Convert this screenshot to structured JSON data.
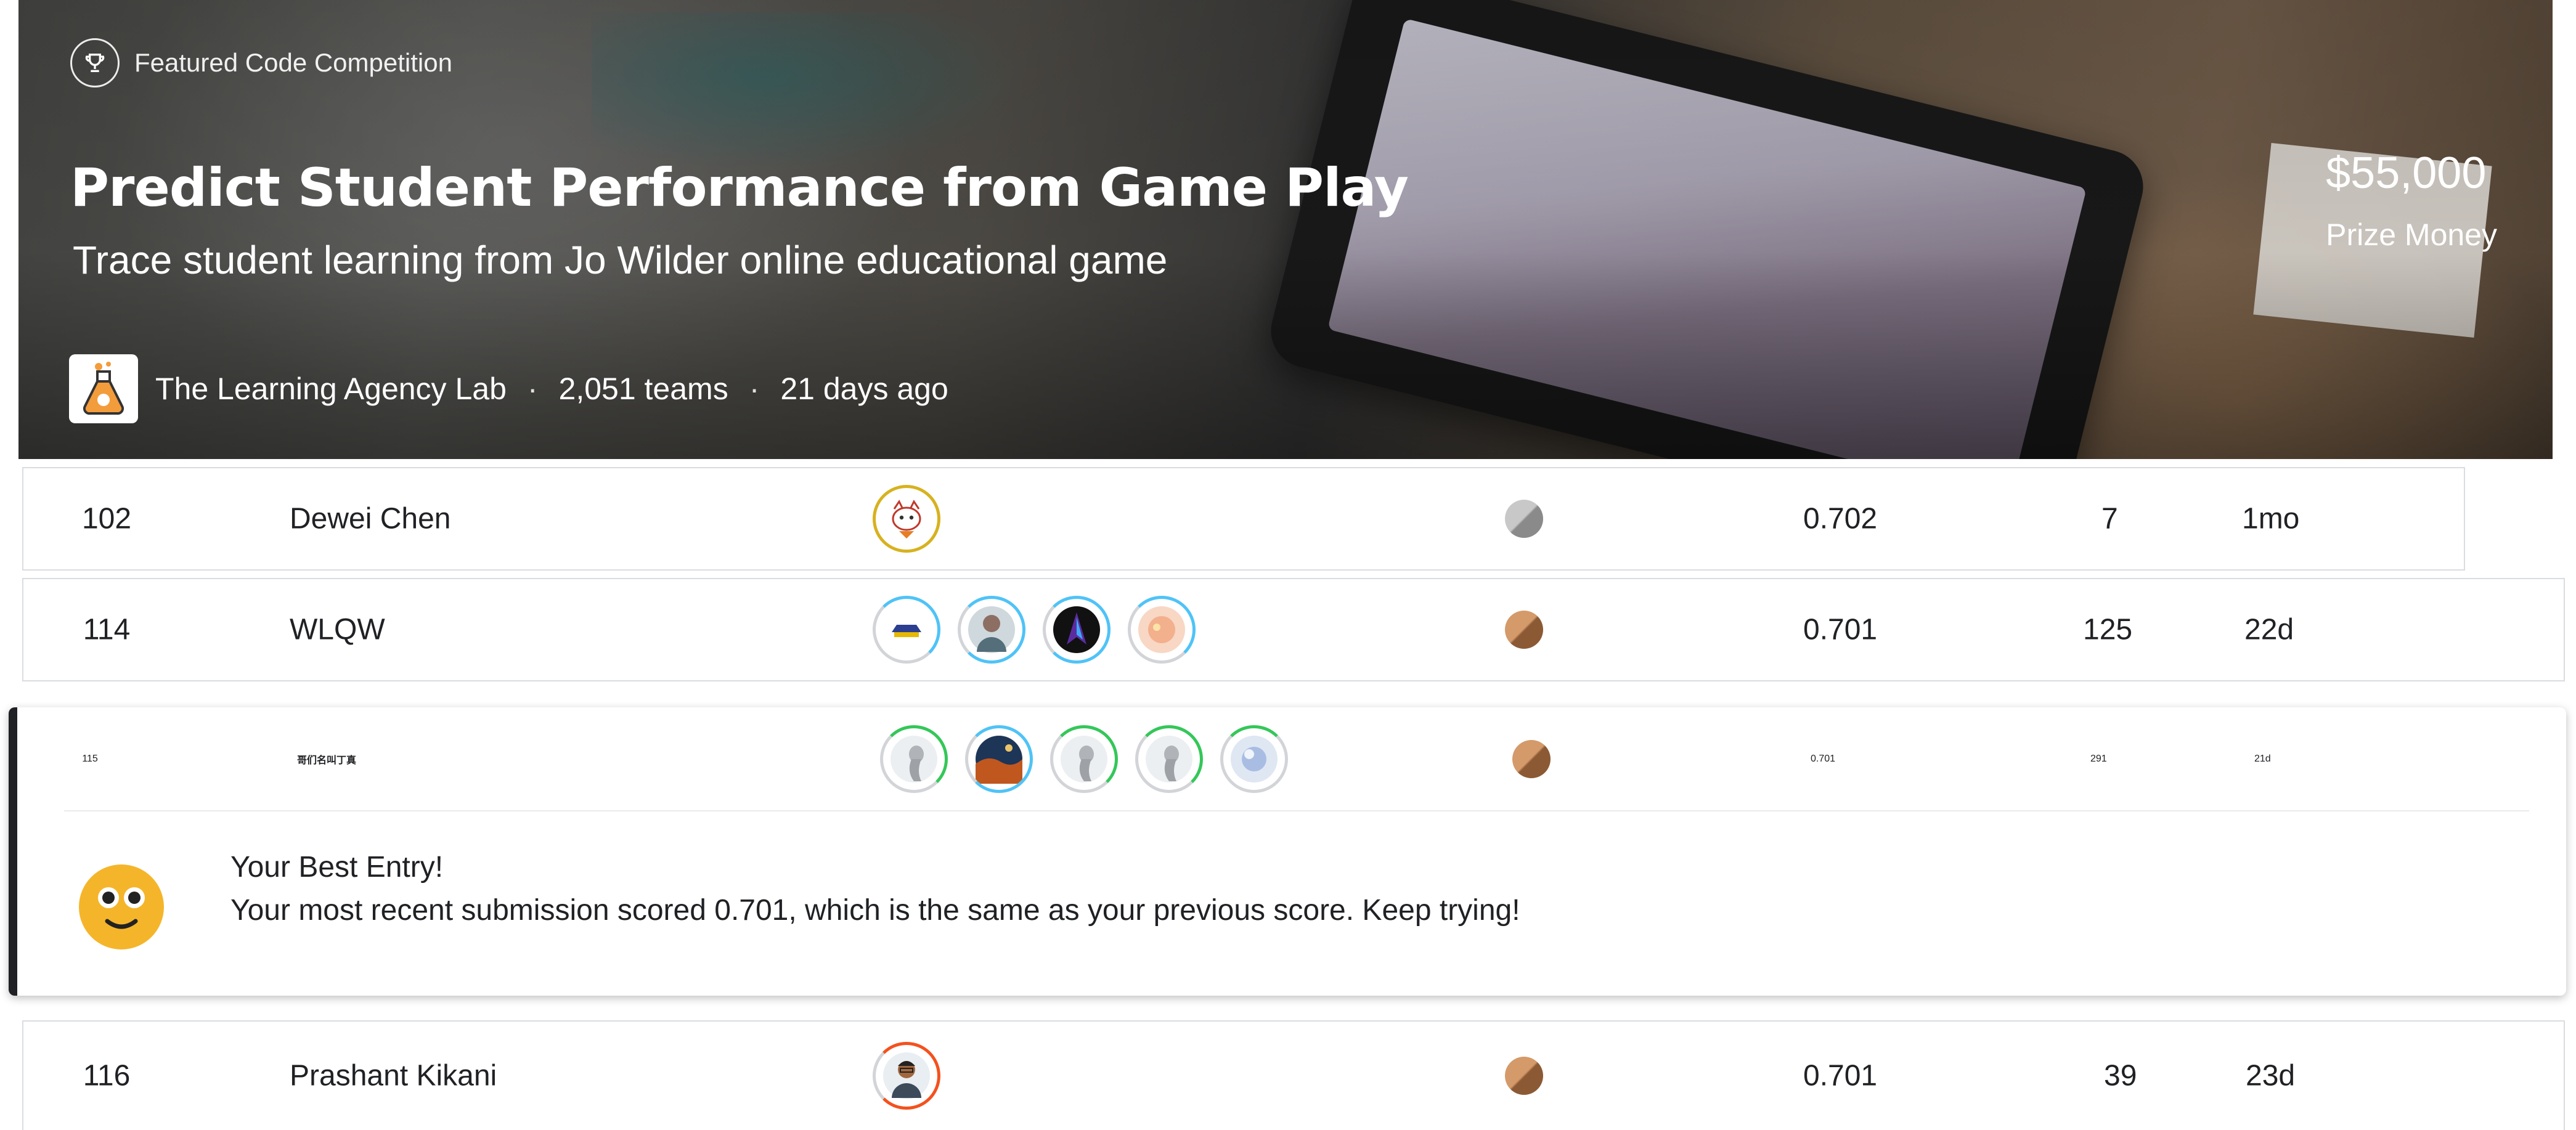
{
  "header": {
    "badge": "Featured Code Competition",
    "title": "Predict Student Performance from Game Play",
    "subtitle": "Trace student learning from Jo Wilder online educational game",
    "host": "The Learning Agency Lab",
    "teams": "2,051 teams",
    "time": "21 days ago",
    "separator": "·",
    "prize_amount": "$55,000",
    "prize_label": "Prize Money"
  },
  "leaderboard": {
    "rows": [
      {
        "rank": "102",
        "name": "Dewei Chen",
        "medal": "silver",
        "score": "0.702",
        "entries": "7",
        "last": "1mo"
      },
      {
        "rank": "114",
        "name": "WLQW",
        "medal": "bronze",
        "score": "0.701",
        "entries": "125",
        "last": "22d"
      },
      {
        "rank": "115",
        "name": "哥们名叫丁真",
        "medal": "bronze",
        "score": "0.701",
        "entries": "291",
        "last": "21d"
      },
      {
        "rank": "116",
        "name": "Prashant Kikani",
        "medal": "bronze",
        "score": "0.701",
        "entries": "39",
        "last": "23d"
      }
    ]
  },
  "best_entry": {
    "title": "Your Best Entry!",
    "message": "Your most recent submission scored 0.701, which is the same as your previous score. Keep trying!"
  },
  "colors": {
    "accent_blue": "#4fc3f7",
    "accent_green": "#34c759",
    "accent_orange": "#f4511e",
    "accent_gold": "#d7b21f",
    "medal_silver": "#9a9a9a",
    "medal_bronze": "#a9703f",
    "emoji_yellow": "#f5b52a"
  }
}
